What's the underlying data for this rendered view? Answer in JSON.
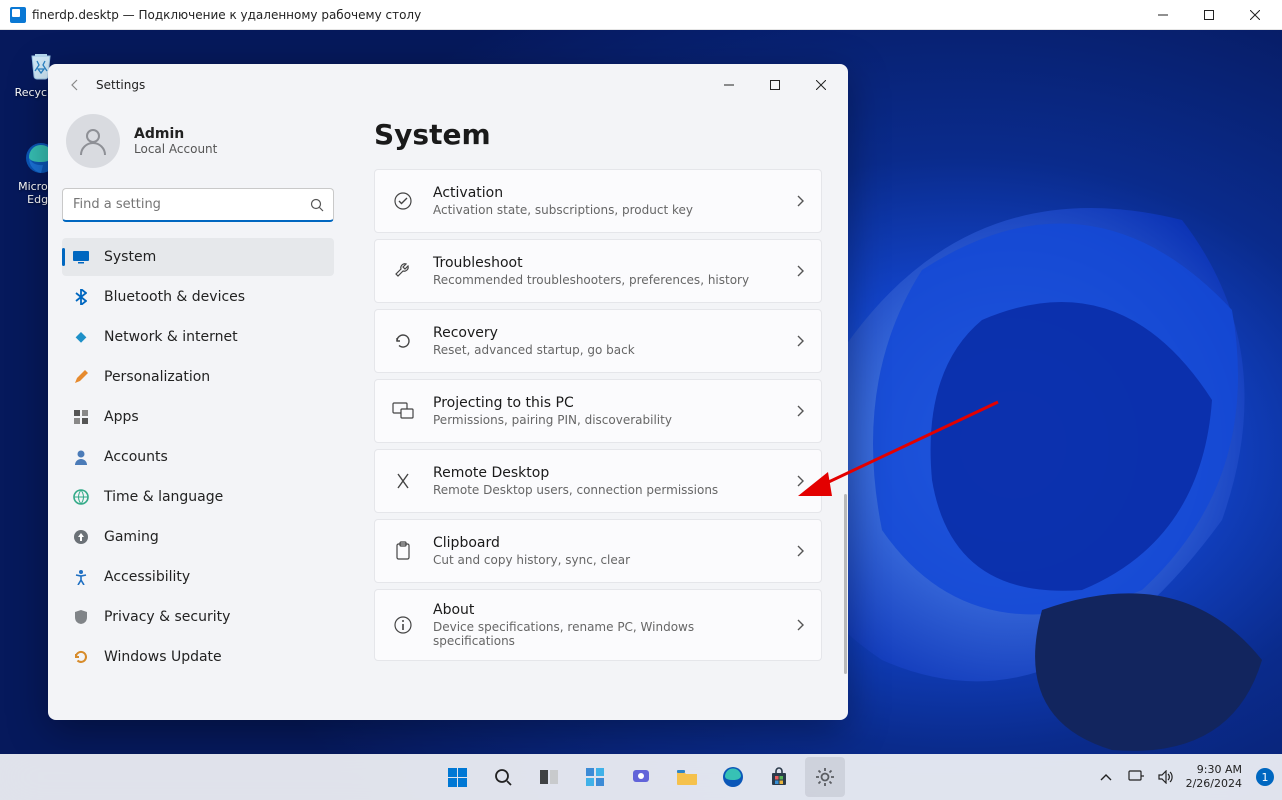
{
  "rdp": {
    "title": "finerdp.desktp — Подключение к удаленному рабочему столу"
  },
  "desktopIcons": {
    "recycle": "Recycle...",
    "edge": "Micros...\nEdge"
  },
  "settings": {
    "appTitle": "Settings",
    "account": {
      "name": "Admin",
      "sub": "Local Account"
    },
    "search": {
      "placeholder": "Find a setting"
    },
    "pageTitle": "System",
    "nav": [
      {
        "label": "System"
      },
      {
        "label": "Bluetooth & devices"
      },
      {
        "label": "Network & internet"
      },
      {
        "label": "Personalization"
      },
      {
        "label": "Apps"
      },
      {
        "label": "Accounts"
      },
      {
        "label": "Time & language"
      },
      {
        "label": "Gaming"
      },
      {
        "label": "Accessibility"
      },
      {
        "label": "Privacy & security"
      },
      {
        "label": "Windows Update"
      }
    ],
    "tiles": [
      {
        "title": "Activation",
        "sub": "Activation state, subscriptions, product key"
      },
      {
        "title": "Troubleshoot",
        "sub": "Recommended troubleshooters, preferences, history"
      },
      {
        "title": "Recovery",
        "sub": "Reset, advanced startup, go back"
      },
      {
        "title": "Projecting to this PC",
        "sub": "Permissions, pairing PIN, discoverability"
      },
      {
        "title": "Remote Desktop",
        "sub": "Remote Desktop users, connection permissions"
      },
      {
        "title": "Clipboard",
        "sub": "Cut and copy history, sync, clear"
      },
      {
        "title": "About",
        "sub": "Device specifications, rename PC, Windows specifications"
      }
    ]
  },
  "tray": {
    "time": "9:30 AM",
    "date": "2/26/2024",
    "notif": "1"
  }
}
